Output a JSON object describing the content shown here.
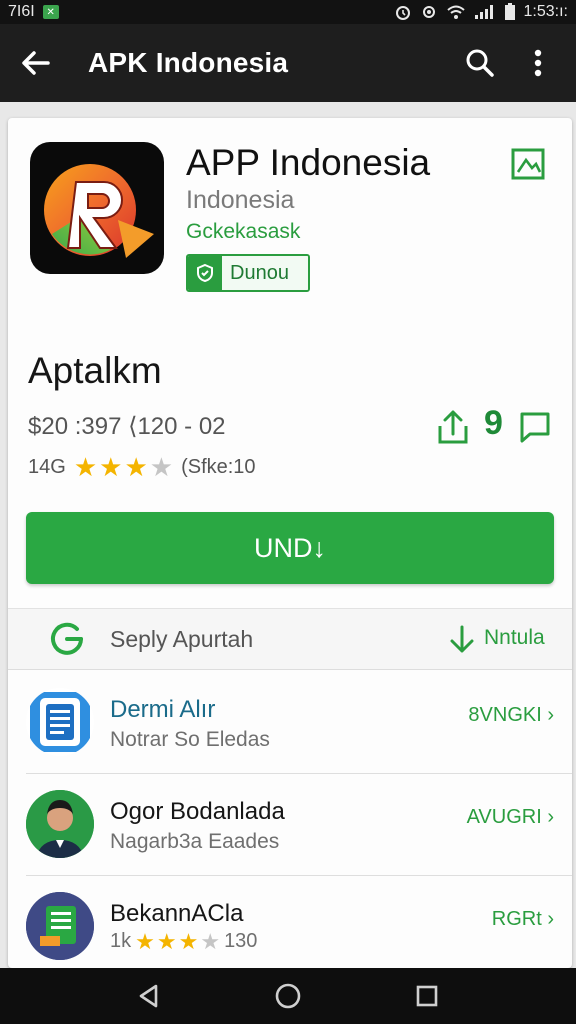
{
  "status_bar": {
    "left_text": "7I6I",
    "time": "1:53:ı:"
  },
  "app_bar": {
    "title": "APK Indonesia"
  },
  "app": {
    "name": "APP Indonesia",
    "subtitle": "Indonesia",
    "developer": "Gckekasask",
    "badge_label": "Dunou"
  },
  "detail": {
    "section_title": "Aptalkm",
    "meta": "$20 :397 ⟨120 - 02",
    "rating_prefix": "14G",
    "rating_value": 3,
    "rating_max": 4,
    "rating_suffix": "(Sfke:10",
    "count": "9"
  },
  "install_button": {
    "label": "UND↓"
  },
  "gbar": {
    "text": "Seply Apurtah",
    "link": "Nntula"
  },
  "list": [
    {
      "title": "Dermi Alır",
      "subtitle": "Notrar So Eledas",
      "link": "8VNGKI ›",
      "icon": "document-app-icon"
    },
    {
      "title": "Ogor Bodanlada",
      "subtitle": "Nagarb3a Eaades",
      "link": "AVUGRI ›",
      "icon": "person-avatar"
    },
    {
      "title": "BekannACla",
      "rating_prefix": "1k",
      "rating_value": 3,
      "rating_max": 4,
      "rating_suffix": "130",
      "link": "RGRt ›",
      "icon": "book-app-icon"
    }
  ],
  "colors": {
    "accent": "#2aa843",
    "accent_text": "#2a9d3f",
    "app_bar": "#1e1e1e",
    "star": "#f4b400"
  }
}
